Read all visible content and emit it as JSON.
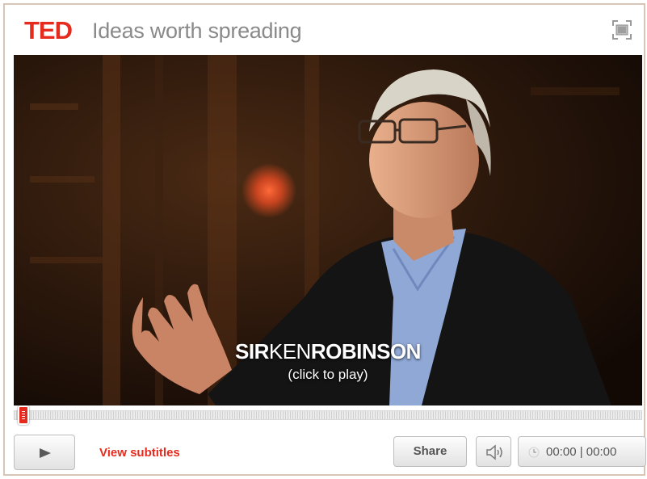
{
  "header": {
    "logo": "TED",
    "tagline": "Ideas worth spreading",
    "fullscreen_icon": "fullscreen-icon"
  },
  "video": {
    "speaker_first": "SIR",
    "speaker_middle": "KEN",
    "speaker_last": "ROBINSON",
    "hint": "(click to play)"
  },
  "progress": {
    "position": 0
  },
  "controls": {
    "play_icon": "play-icon",
    "subtitles_label": "View subtitles",
    "share_label": "Share",
    "volume_icon": "speaker-volume-icon",
    "time": "00:00 | 00:00"
  },
  "colors": {
    "ted_red": "#e62b1e",
    "tagline_gray": "#8a8a8a",
    "frame_border": "#d7c6b7"
  }
}
